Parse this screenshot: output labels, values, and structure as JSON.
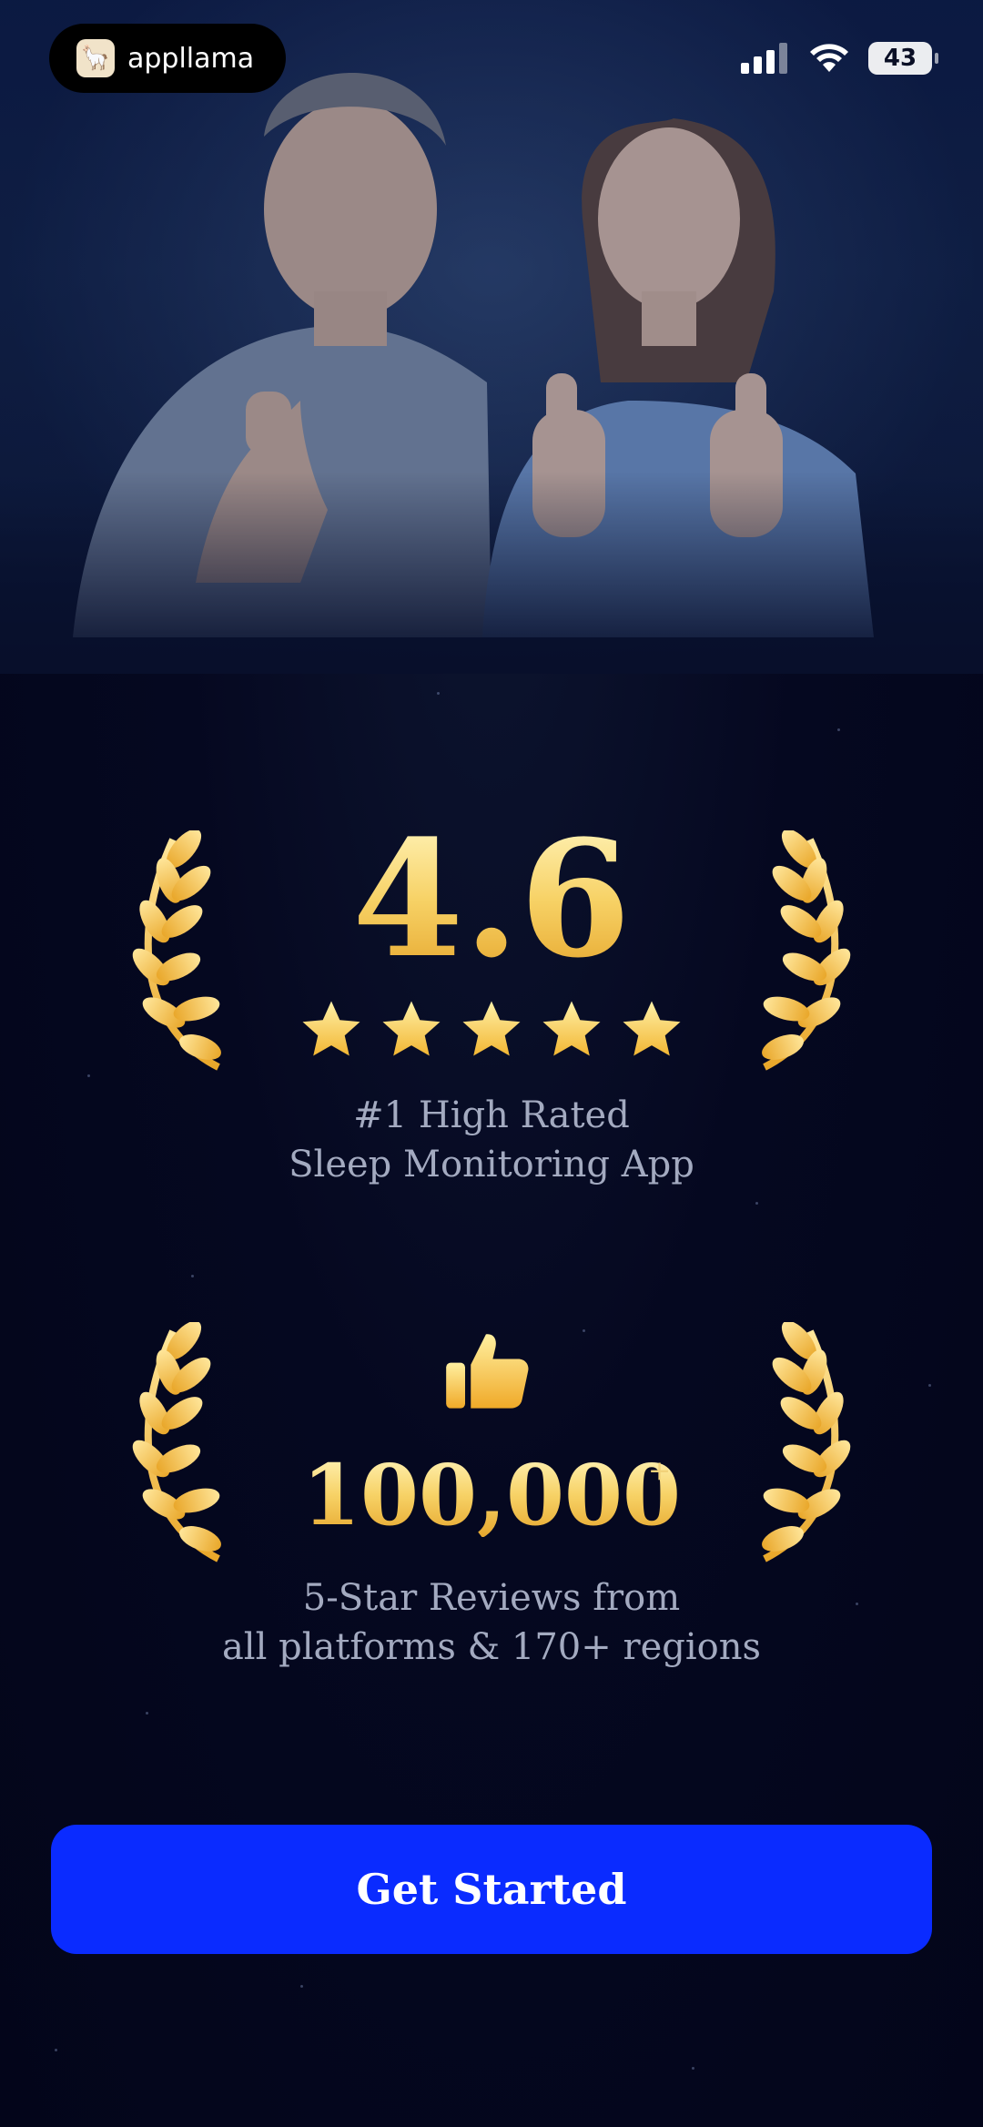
{
  "status_bar": {
    "app_name": "appllama",
    "battery": "43"
  },
  "rating": {
    "value": "4.6",
    "stars": 5,
    "caption_line1": "#1 High Rated",
    "caption_line2": "Sleep Monitoring App"
  },
  "reviews": {
    "count": "100,000",
    "count_suffix": "+",
    "caption_line1": "5-Star Reviews from",
    "caption_line2": "all platforms & 170+ regions"
  },
  "cta": {
    "label": "Get Started"
  },
  "colors": {
    "accent": "#0a2bff",
    "gold": "#f7cc5c",
    "background": "#04061a",
    "caption": "#a3aac0"
  },
  "icons": [
    "app-logo-icon",
    "signal-icon",
    "wifi-icon",
    "battery-icon",
    "star-icon",
    "thumbs-up-icon",
    "laurel-left-icon",
    "laurel-right-icon"
  ]
}
